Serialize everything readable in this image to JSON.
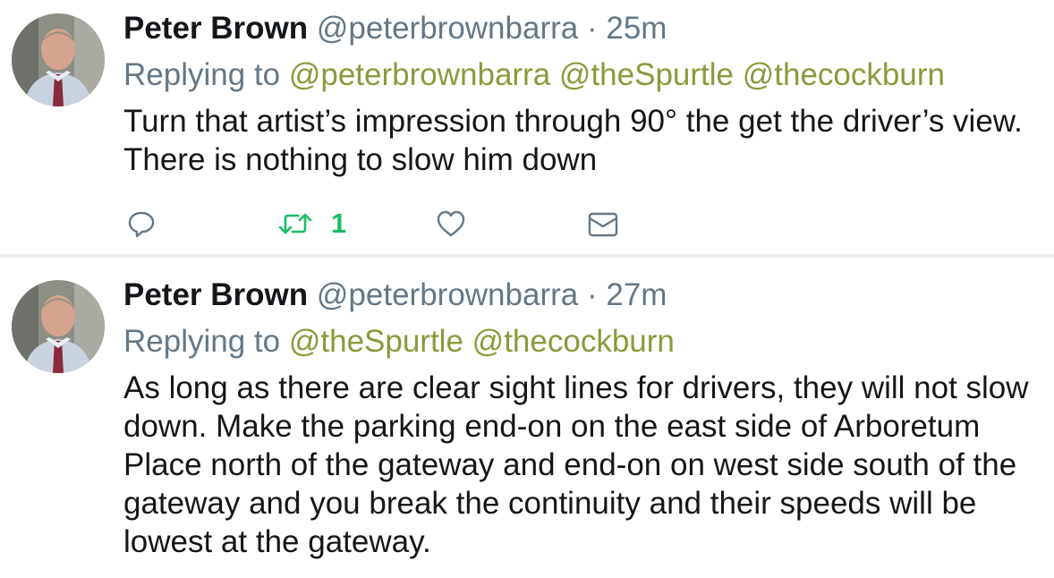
{
  "tweets": [
    {
      "name": "Peter Brown",
      "handle": "@peterbrownbarra",
      "separator": "·",
      "time": "25m",
      "replying_label": "Replying to",
      "mentions": [
        "@peterbrownbarra",
        "@theSpurtle",
        "@thecockburn"
      ],
      "text": "Turn that artist’s impression through 90° the get the driver’s view.  There is nothing to slow him down",
      "actions": {
        "reply_icon": "reply-icon",
        "retweet_icon": "retweet-icon",
        "retweet_count": "1",
        "like_icon": "heart-icon",
        "dm_icon": "envelope-icon"
      }
    },
    {
      "name": "Peter Brown",
      "handle": "@peterbrownbarra",
      "separator": "·",
      "time": "27m",
      "replying_label": "Replying to",
      "mentions": [
        "@theSpurtle",
        "@thecockburn"
      ],
      "text": "As long as there are clear sight lines for drivers, they will not slow down. Make the parking end-on on the east side of Arboretum Place north of the gateway and end-on on west side south of the gateway and you break the continuity and their speeds will be lowest at the gateway."
    }
  ],
  "colors": {
    "text": "#14171a",
    "secondary": "#657786",
    "mention": "#8a9a3b",
    "retweet_active": "#17bf63",
    "icon": "#657786",
    "separator": "#e6ecf0"
  }
}
